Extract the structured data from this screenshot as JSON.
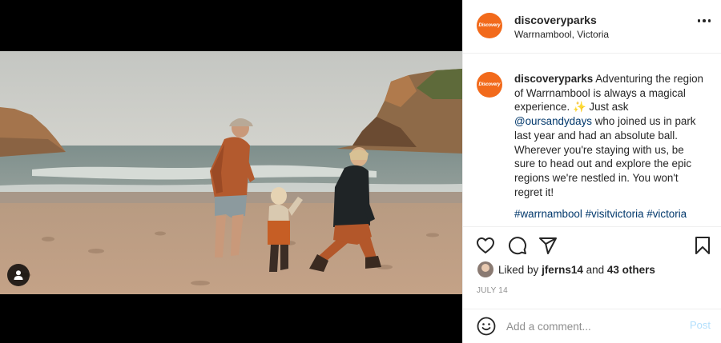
{
  "account": {
    "username": "discoveryparks",
    "location": "Warrnambool, Victoria",
    "avatar_text": "Discovery",
    "brand_color": "#f26a1b"
  },
  "caption": {
    "username": "discoveryparks",
    "text_1": "Adventuring the region of Warrnambool is always a magical experience.",
    "emoji": "✨",
    "text_2": "Just ask",
    "mention": "@oursandydays",
    "text_3": "who joined us in park last year and had an absolute ball. Wherever you're staying with us, be sure to head out and explore the epic regions we're nestled in. You won't regret it!",
    "hashtags": [
      "#warrnambool",
      "#visitvictoria",
      "#victoria"
    ]
  },
  "actions": {
    "like_icon": "heart-icon",
    "comment_icon": "comment-icon",
    "share_icon": "paper-plane-icon",
    "save_icon": "bookmark-icon"
  },
  "likes": {
    "prefix": "Liked by",
    "user": "jferns14",
    "conjunction": "and",
    "others": "43 others"
  },
  "date": "JULY 14",
  "comment_box": {
    "placeholder": "Add a comment...",
    "post_label": "Post"
  }
}
